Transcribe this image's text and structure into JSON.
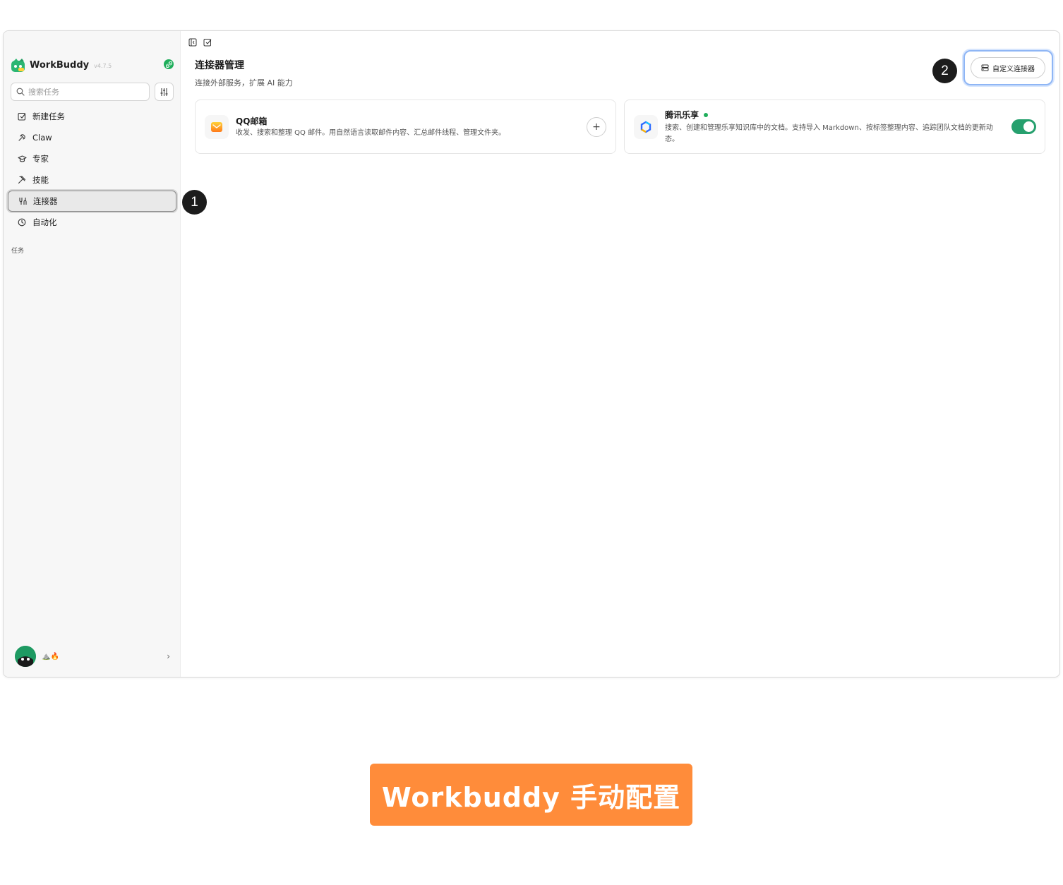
{
  "app": {
    "name": "WorkBuddy",
    "version": "v4.7.5"
  },
  "sidebar": {
    "search_placeholder": "搜索任务",
    "items": [
      {
        "label": "新建任务",
        "icon": "edit-square-icon"
      },
      {
        "label": "Claw",
        "icon": "claw-icon"
      },
      {
        "label": "专家",
        "icon": "graduation-cap-icon"
      },
      {
        "label": "技能",
        "icon": "tools-icon"
      },
      {
        "label": "连接器",
        "icon": "connector-icon",
        "active": true
      },
      {
        "label": "自动化",
        "icon": "clock-icon"
      }
    ],
    "section_label": "任务",
    "user": {
      "emoji": "⛰️🔥"
    }
  },
  "main": {
    "title": "连接器管理",
    "subtitle": "连接外部服务，扩展 AI 能力",
    "custom_button": "自定义连接器",
    "connectors": [
      {
        "name": "QQ邮箱",
        "description": "收发、搜索和整理 QQ 邮件。用自然语言读取邮件内容、汇总邮件线程、管理文件夹。",
        "action": "+",
        "connected": false
      },
      {
        "name": "腾讯乐享",
        "description": "搜索、创建和管理乐享知识库中的文档。支持导入 Markdown、按标签整理内容、追踪团队文档的更新动态。",
        "connected": true
      }
    ]
  },
  "callouts": [
    "1",
    "2"
  ],
  "banner": {
    "text": "Workbuddy 手动配置"
  },
  "colors": {
    "accent_green": "#26a06e",
    "banner_orange": "#ff8c3a",
    "focus_blue": "#8fb6f5"
  }
}
